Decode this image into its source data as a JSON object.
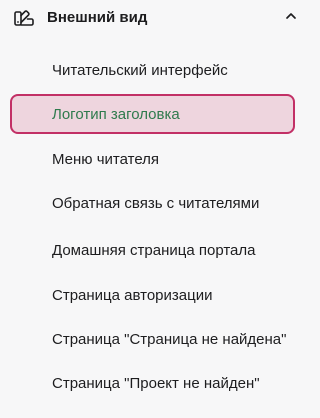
{
  "section": {
    "title": "Внешний вид",
    "icon": "appearance-icon",
    "toggle_icon": "chevron-up-icon"
  },
  "menu": {
    "items": [
      {
        "label": "Читательский интерфейс",
        "active": false
      },
      {
        "label": "Логотип заголовка",
        "active": true
      },
      {
        "label": "Меню читателя",
        "active": false
      },
      {
        "label": "Обратная связь с читателями",
        "active": false
      },
      {
        "label": "Домашняя страница портала",
        "active": false
      },
      {
        "label": "Страница авторизации",
        "active": false
      },
      {
        "label": "Страница \"Страница не найдена\"",
        "active": false
      },
      {
        "label": "Страница \"Проект не найден\"",
        "active": false
      }
    ]
  },
  "colors": {
    "active_background": "#eed5de",
    "active_border": "#c23066",
    "active_text": "#2f7a4d",
    "text": "#1d1d1f",
    "background": "#f7f7f8"
  }
}
